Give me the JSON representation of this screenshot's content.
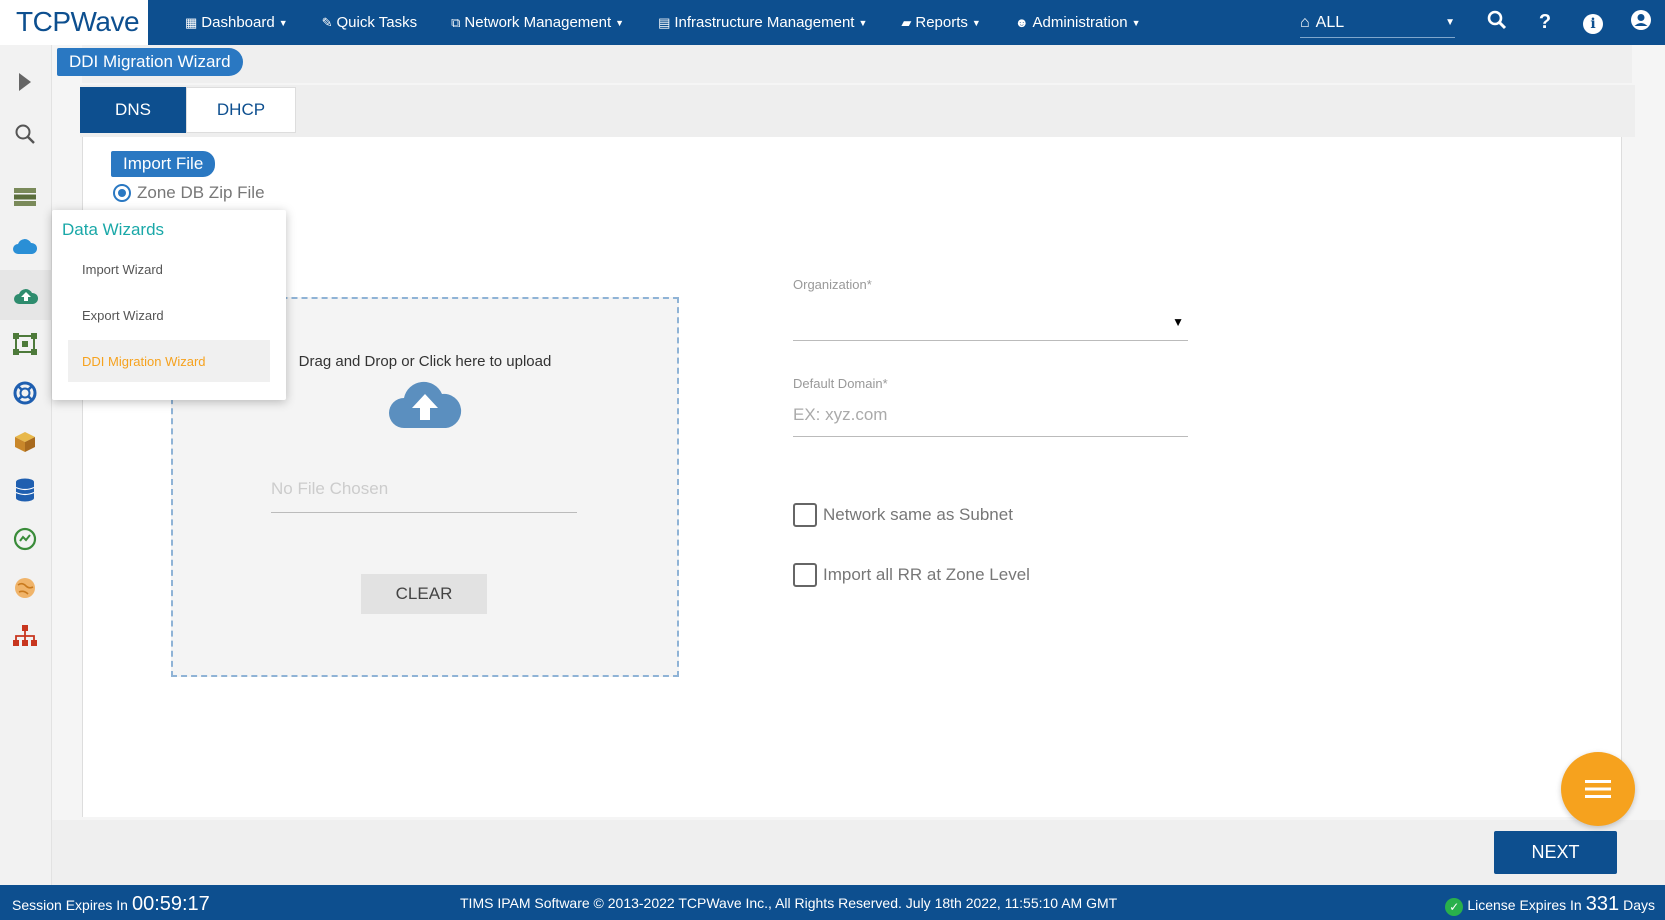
{
  "brand": {
    "logo": "TCPWave"
  },
  "nav": [
    {
      "label": "Dashboard",
      "icon": "grid-icon"
    },
    {
      "label": "Quick Tasks",
      "icon": "wand-icon"
    },
    {
      "label": "Network Management",
      "icon": "sitemap-icon"
    },
    {
      "label": "Infrastructure Management",
      "icon": "server-icon"
    },
    {
      "label": "Reports",
      "icon": "book-icon"
    },
    {
      "label": "Administration",
      "icon": "users-icon"
    }
  ],
  "org_select": {
    "value": "ALL"
  },
  "top_icons": [
    "search-icon",
    "help-icon",
    "info-icon",
    "user-icon"
  ],
  "breadcrumb": "DDI Migration Wizard",
  "tabs": [
    {
      "label": "DNS",
      "active": true
    },
    {
      "label": "DHCP",
      "active": false
    }
  ],
  "import": {
    "label": "Import File",
    "radio_label": "Zone DB Zip File",
    "dropzone_text": "Drag and Drop or Click here to upload",
    "file_placeholder": "No File Chosen",
    "clear_label": "CLEAR"
  },
  "form": {
    "organization_label": "Organization*",
    "organization_value": "",
    "default_domain_label": "Default Domain*",
    "default_domain_placeholder": "EX: xyz.com",
    "network_same_label": "Network same as Subnet",
    "import_rr_label": "Import all RR at Zone Level"
  },
  "popup": {
    "title": "Data Wizards",
    "items": [
      {
        "label": "Import Wizard",
        "active": false
      },
      {
        "label": "Export Wizard",
        "active": false
      },
      {
        "label": "DDI Migration Wizard",
        "active": true
      }
    ]
  },
  "actions": {
    "next_label": "NEXT"
  },
  "status": {
    "session_label": "Session Expires In",
    "session_time": "00:59:17",
    "copyright": "TIMS IPAM Software © 2013-2022 TCPWave Inc., All Rights Reserved.  July 18th 2022, 11:55:10 AM GMT",
    "license_label": "License Expires In",
    "license_days": "331",
    "license_unit": "Days"
  },
  "colors": {
    "primary": "#0d4f8f",
    "accent": "#2a78c2",
    "fab": "#f6a21e",
    "popup_title": "#1aa8a8",
    "license_ok": "#29b04b"
  }
}
